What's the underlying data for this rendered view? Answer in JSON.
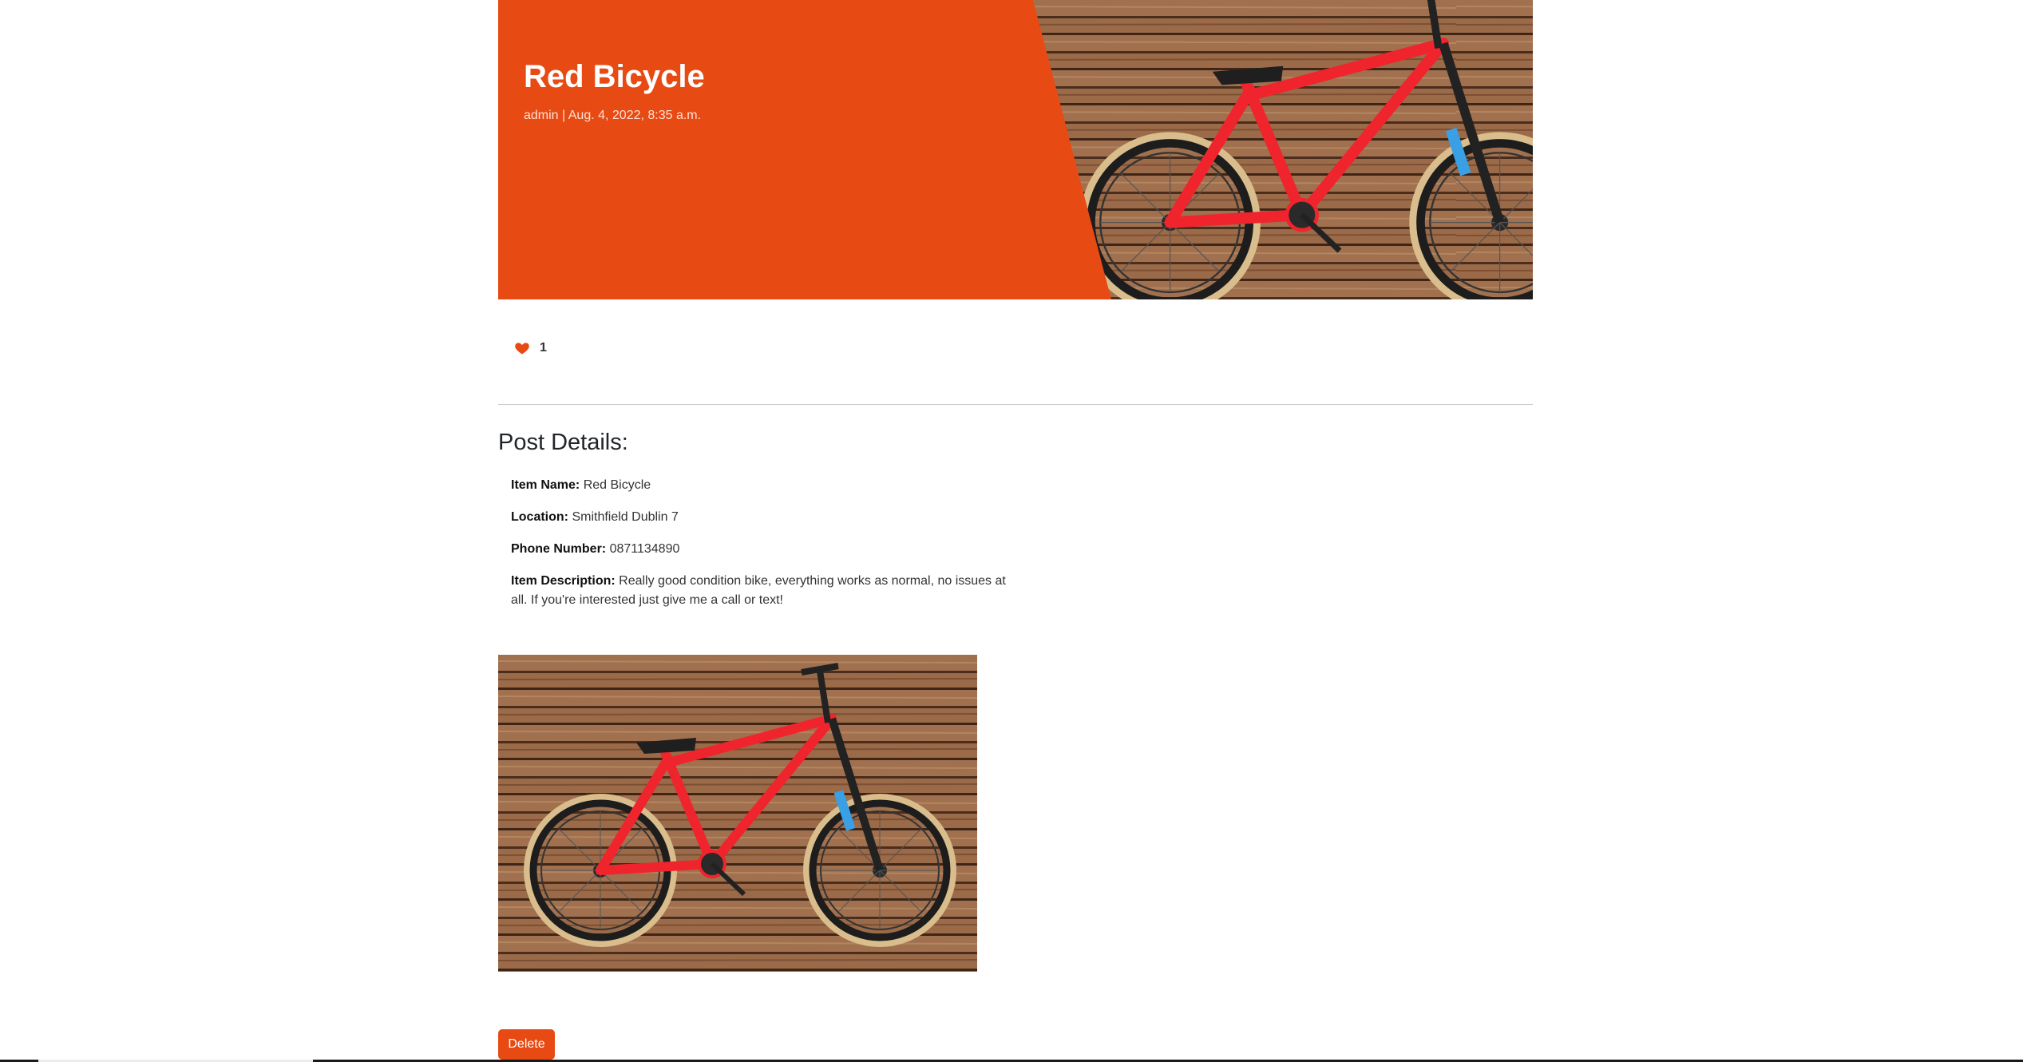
{
  "post": {
    "title": "Red Bicycle",
    "meta": "admin | Aug. 4, 2022, 8:35 a.m.",
    "like_count": "1"
  },
  "details": {
    "heading": "Post Details:",
    "item_name_label": "Item Name:",
    "item_name": "Red Bicycle",
    "location_label": "Location:",
    "location": "Smithfield Dublin 7",
    "phone_label": "Phone Number:",
    "phone": "0871134890",
    "description_label": "Item Description:",
    "description": "Really good condition bike, everything works as normal, no issues at all. If you're interested just give me a call or text!"
  },
  "actions": {
    "delete_label": "Delete"
  },
  "icons": {
    "like": "heart-icon"
  },
  "colors": {
    "accent": "#e84a13",
    "bike": "#f0242c"
  }
}
